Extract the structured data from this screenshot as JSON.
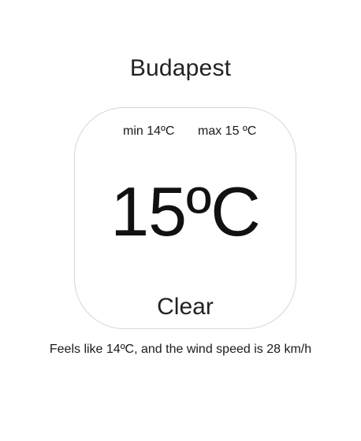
{
  "location": {
    "city": "Budapest"
  },
  "weather": {
    "min": "min 14ºC",
    "max": "max 15 ºC",
    "temperature": "15ºC",
    "condition": "Clear",
    "details": "Feels like 14ºC, and the wind speed is 28 km/h"
  }
}
